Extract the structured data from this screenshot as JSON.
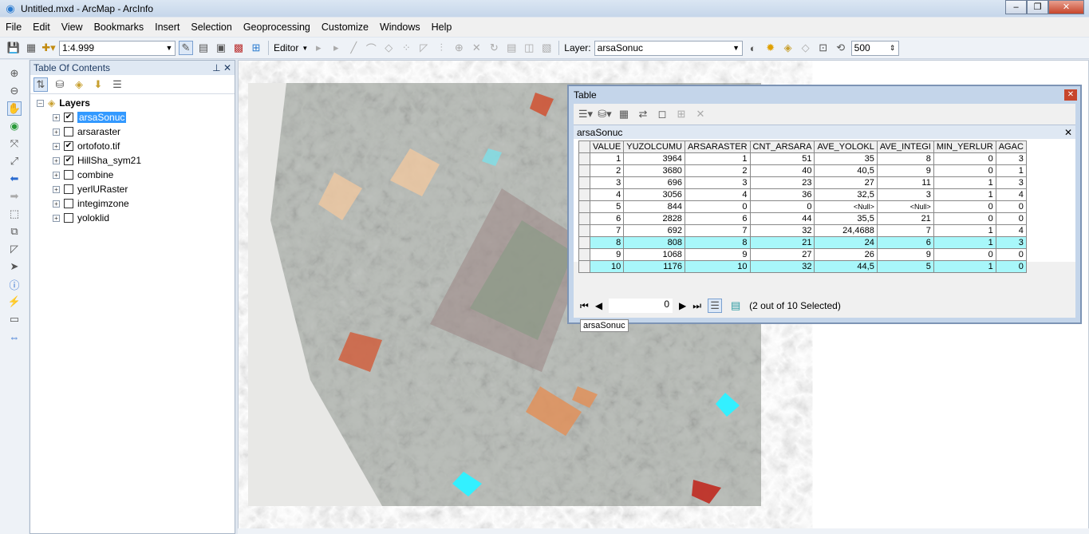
{
  "window": {
    "title": "Untitled.mxd - ArcMap - ArcInfo"
  },
  "menu": [
    "File",
    "Edit",
    "View",
    "Bookmarks",
    "Insert",
    "Selection",
    "Geoprocessing",
    "Customize",
    "Windows",
    "Help"
  ],
  "toolbar": {
    "scale": "1:4.999",
    "editor": "Editor",
    "layer_label": "Layer:",
    "layer_value": "arsaSonuc",
    "zoom_value": "500"
  },
  "toc": {
    "title": "Table Of Contents",
    "root": "Layers",
    "layers": [
      {
        "name": "arsaSonuc",
        "checked": true,
        "selected": true
      },
      {
        "name": "arsaraster",
        "checked": false
      },
      {
        "name": "ortofoto.tif",
        "checked": true
      },
      {
        "name": "HillSha_sym21",
        "checked": true
      },
      {
        "name": "combine",
        "checked": false
      },
      {
        "name": "yerlURaster",
        "checked": false
      },
      {
        "name": "integimzone",
        "checked": false
      },
      {
        "name": "yoloklid",
        "checked": false
      }
    ]
  },
  "table": {
    "title": "Table",
    "table_name": "arsaSonuc",
    "columns": [
      "VALUE",
      "YUZOLCUMU",
      "ARSARASTER",
      "CNT_ARSARA",
      "AVE_YOLOKL",
      "AVE_INTEGI",
      "MIN_YERLUR",
      "AGAC"
    ],
    "rows": [
      [
        "1",
        "3964",
        "1",
        "51",
        "35",
        "8",
        "0",
        "3"
      ],
      [
        "2",
        "3680",
        "2",
        "40",
        "40,5",
        "9",
        "0",
        "1"
      ],
      [
        "3",
        "696",
        "3",
        "23",
        "27",
        "11",
        "1",
        "3"
      ],
      [
        "4",
        "3056",
        "4",
        "36",
        "32,5",
        "3",
        "1",
        "4"
      ],
      [
        "5",
        "844",
        "0",
        "0",
        "<Null>",
        "<Null>",
        "0",
        "0"
      ],
      [
        "6",
        "2828",
        "6",
        "44",
        "35,5",
        "21",
        "0",
        "0"
      ],
      [
        "7",
        "692",
        "7",
        "32",
        "24,4688",
        "7",
        "1",
        "4"
      ],
      [
        "8",
        "808",
        "8",
        "21",
        "24",
        "6",
        "1",
        "3"
      ],
      [
        "9",
        "1068",
        "9",
        "27",
        "26",
        "9",
        "0",
        "0"
      ],
      [
        "10",
        "1176",
        "10",
        "32",
        "44,5",
        "5",
        "1",
        "0"
      ]
    ],
    "selected_rows": [
      7,
      9
    ],
    "record_index": "0",
    "selection_status": "(2 out of 10 Selected)",
    "tab": "arsaSonuc"
  },
  "colors": {
    "selection": "#a8f7fa",
    "cyan_polygon": "#33f0ff"
  }
}
